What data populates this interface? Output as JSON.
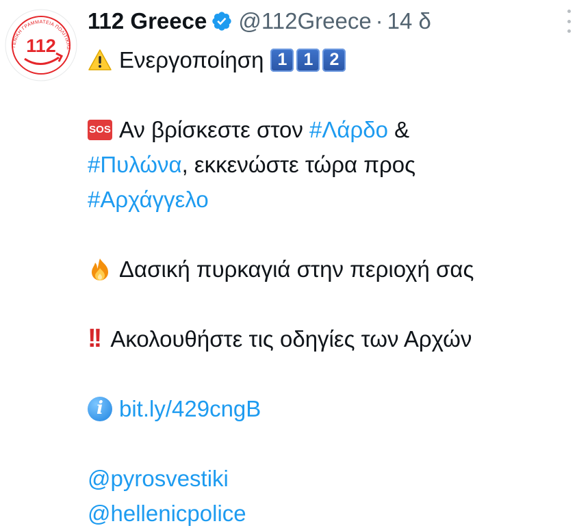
{
  "account": {
    "display_name": "112 Greece",
    "handle": "@112Greece",
    "separator": "·",
    "time": "14 δ",
    "avatar_number": "112",
    "avatar_text": "ΓΕΝΙΚΗ ΓΡΑΜΜΑΤΕΙΑ ΠΟΛΙΤΙΚΗΣ ΠΡΟΣΤΑΣΙΑΣ"
  },
  "icons": {
    "verified": "verified-badge-icon",
    "more": "more-options-icon",
    "warning": "warning-icon",
    "sos": "sos-icon",
    "fire": "fire-icon",
    "double_exclamation": "double-exclamation-icon",
    "info": "info-icon"
  },
  "colors": {
    "link": "#1d9bf0",
    "secondary_text": "#536471",
    "verified": "#1d9bf0",
    "keycap": "#2f62b8",
    "sos": "#e23b3b",
    "alert": "#d6262a"
  },
  "tweet": {
    "line1": {
      "text": "Ενεργοποίηση",
      "keycaps": [
        "1",
        "1",
        "2"
      ]
    },
    "line2": {
      "sos_label": "SOS",
      "prefix": "Αν βρίσκεστε στον ",
      "hashtag1": "#Λάρδο",
      "suffix": " &"
    },
    "line3": {
      "hashtag2": "#Πυλώνα",
      "text": ", εκκενώστε τώρα προς"
    },
    "line4": {
      "hashtag3": "#Αρχάγγελο"
    },
    "line5": {
      "text": "Δασική πυρκαγιά στην περιοχή σας"
    },
    "line6": {
      "bang": "!!",
      "text": "Ακολουθήστε τις οδηγίες των Αρχών"
    },
    "line7": {
      "info_glyph": "i",
      "link": "bit.ly/429cngB"
    },
    "mentions": [
      "@pyrosvestiki",
      "@hellenicpolice"
    ]
  }
}
